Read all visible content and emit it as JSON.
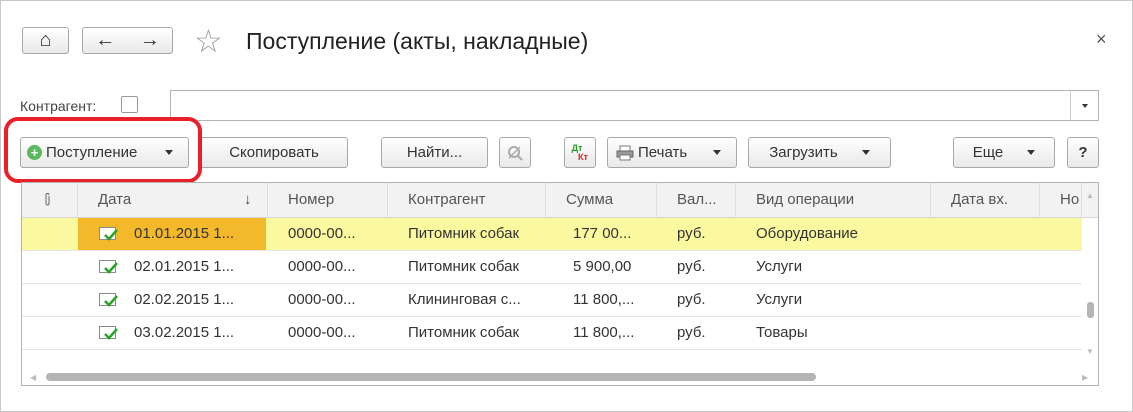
{
  "window": {
    "title": "Поступление (акты, накладные)",
    "close_glyph": "×"
  },
  "nav": {
    "home_glyph": "⌂",
    "back_glyph": "←",
    "forward_glyph": "→",
    "favorite_glyph": "☆"
  },
  "filter": {
    "label": "Контрагент:",
    "value": ""
  },
  "toolbar": {
    "create_label": "Поступление",
    "copy_label": "Скопировать",
    "find_label": "Найти...",
    "dtkt_top": "Дт",
    "dtkt_bottom": "Кт",
    "print_label": "Печать",
    "load_label": "Загрузить",
    "more_label": "Еще",
    "help_label": "?"
  },
  "table": {
    "headers": {
      "attach": "",
      "date": "Дата",
      "sort_glyph": "↓",
      "number": "Номер",
      "contractor": "Контрагент",
      "sum": "Сумма",
      "currency": "Вал...",
      "operation": "Вид операции",
      "date_in": "Дата вх.",
      "number_in": "Но"
    },
    "rows": [
      {
        "date": "01.01.2015 1...",
        "number": "0000-00...",
        "contractor": "Питомник собак",
        "sum": "177 00...",
        "currency": "руб.",
        "operation": "Оборудование"
      },
      {
        "date": "02.01.2015 1...",
        "number": "0000-00...",
        "contractor": "Питомник собак",
        "sum": "5 900,00",
        "currency": "руб.",
        "operation": "Услуги"
      },
      {
        "date": "02.02.2015 1...",
        "number": "0000-00...",
        "contractor": "Клининговая с...",
        "sum": "11 800,...",
        "currency": "руб.",
        "operation": "Услуги"
      },
      {
        "date": "03.02.2015 1...",
        "number": "0000-00...",
        "contractor": "Питомник собак",
        "sum": "11 800,...",
        "currency": "руб.",
        "operation": "Товары"
      }
    ]
  },
  "colors": {
    "selected_row": "#fbf9a0",
    "selected_cell": "#f4b92b",
    "highlight": "#e8202a"
  }
}
